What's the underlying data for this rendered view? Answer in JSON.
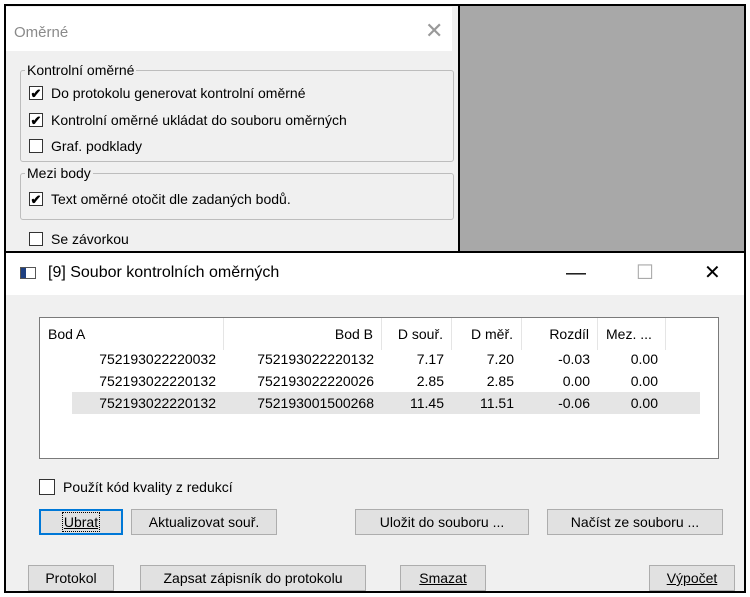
{
  "back_dialog": {
    "title": "Oměrné",
    "group1": {
      "label": "Kontrolní oměrné",
      "items": [
        {
          "label": "Do protokolu generovat kontrolní oměrné",
          "checked": true
        },
        {
          "label": "Kontrolní oměrné ukládat do souboru oměrných",
          "checked": true
        },
        {
          "label": "Graf. podklady",
          "checked": false
        }
      ]
    },
    "group2": {
      "label": "Mezi body",
      "items": [
        {
          "label": "Text oměrné otočit dle zadaných bodů.",
          "checked": true
        }
      ]
    },
    "se_zavorkou": {
      "label": "Se závorkou",
      "checked": false
    }
  },
  "front_dialog": {
    "title": "[9] Soubor kontrolních oměrných",
    "minimize": "—",
    "maximize": "☐",
    "close": "✕",
    "columns": [
      "Bod A",
      "Bod B",
      "D souř.",
      "D měř.",
      "Rozdíl",
      "Mez. ..."
    ],
    "rows": [
      [
        "752193022220032",
        "752193022220132",
        "7.17",
        "7.20",
        "-0.03",
        "0.00"
      ],
      [
        "752193022220132",
        "752193022220026",
        "2.85",
        "2.85",
        "0.00",
        "0.00"
      ],
      [
        "752193022220132",
        "752193001500268",
        "11.45",
        "11.51",
        "-0.06",
        "0.00"
      ]
    ],
    "selected_row": 2,
    "use_quality_code": {
      "label": "Použít kód kvality z redukcí",
      "checked": false
    },
    "buttons": {
      "ubrat": "Ubrat",
      "aktualizovat": "Aktualizovat souř.",
      "ulozit": "Uložit do souboru ...",
      "nacist": "Načíst ze souboru ...",
      "protokol": "Protokol",
      "zapsat": "Zapsat zápisník do protokolu",
      "smazat": "Smazat",
      "vypocet": "Výpočet"
    }
  },
  "colors": {
    "dialog_bg": "#f0f0f0",
    "background_area": "#a8a8a8",
    "selected_row": "#e5e5e5",
    "focus_border": "#0078d7"
  }
}
